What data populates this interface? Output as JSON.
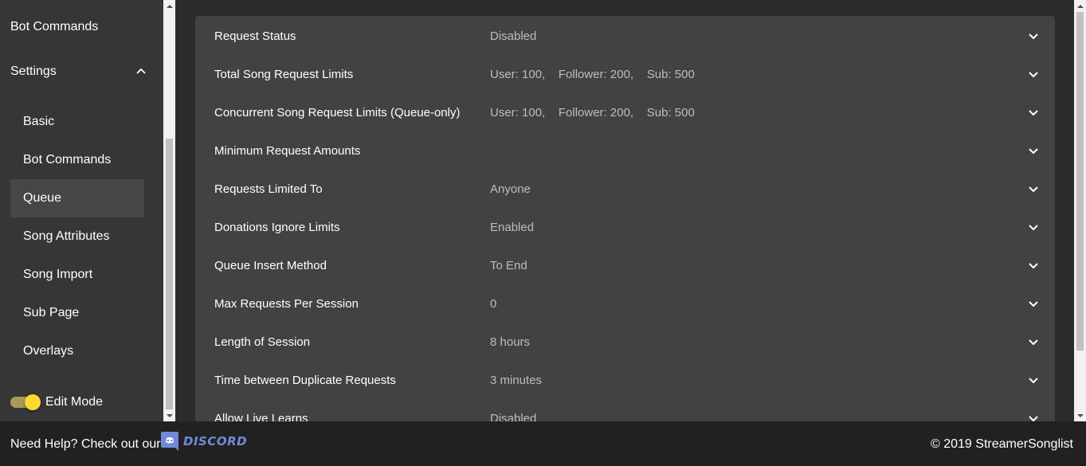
{
  "sidebar": {
    "top_item": "Bot Commands",
    "settings_label": "Settings",
    "sub_items": [
      {
        "label": "Basic"
      },
      {
        "label": "Bot Commands"
      },
      {
        "label": "Queue",
        "active": true
      },
      {
        "label": "Song Attributes"
      },
      {
        "label": "Song Import"
      },
      {
        "label": "Sub Page"
      },
      {
        "label": "Overlays"
      }
    ],
    "edit_mode_label": "Edit Mode",
    "edit_mode_on": true
  },
  "settings_rows": [
    {
      "label": "Request Status",
      "value": "Disabled"
    },
    {
      "label": "Total Song Request Limits",
      "value": "User: 100,    Follower: 200,    Sub: 500"
    },
    {
      "label": "Concurrent Song Request Limits (Queue-only)",
      "value": "User: 100,    Follower: 200,    Sub: 500"
    },
    {
      "label": "Minimum Request Amounts",
      "value": ""
    },
    {
      "label": "Requests Limited To",
      "value": "Anyone"
    },
    {
      "label": "Donations Ignore Limits",
      "value": "Enabled"
    },
    {
      "label": "Queue Insert Method",
      "value": "To End"
    },
    {
      "label": "Max Requests Per Session",
      "value": "0"
    },
    {
      "label": "Length of Session",
      "value": "8 hours"
    },
    {
      "label": "Time between Duplicate Requests",
      "value": "3 minutes"
    },
    {
      "label": "Allow Live Learns",
      "value": "Disabled"
    }
  ],
  "footer": {
    "help_text": "Need Help? Check out our",
    "discord_label": "DISCORD",
    "copyright": "© 2019 StreamerSonglist"
  },
  "colors": {
    "sidebar_bg": "#363636",
    "panel_bg": "#424242",
    "footer_bg": "#212121",
    "toggle_knob": "#fdd835",
    "discord": "#7289da"
  }
}
